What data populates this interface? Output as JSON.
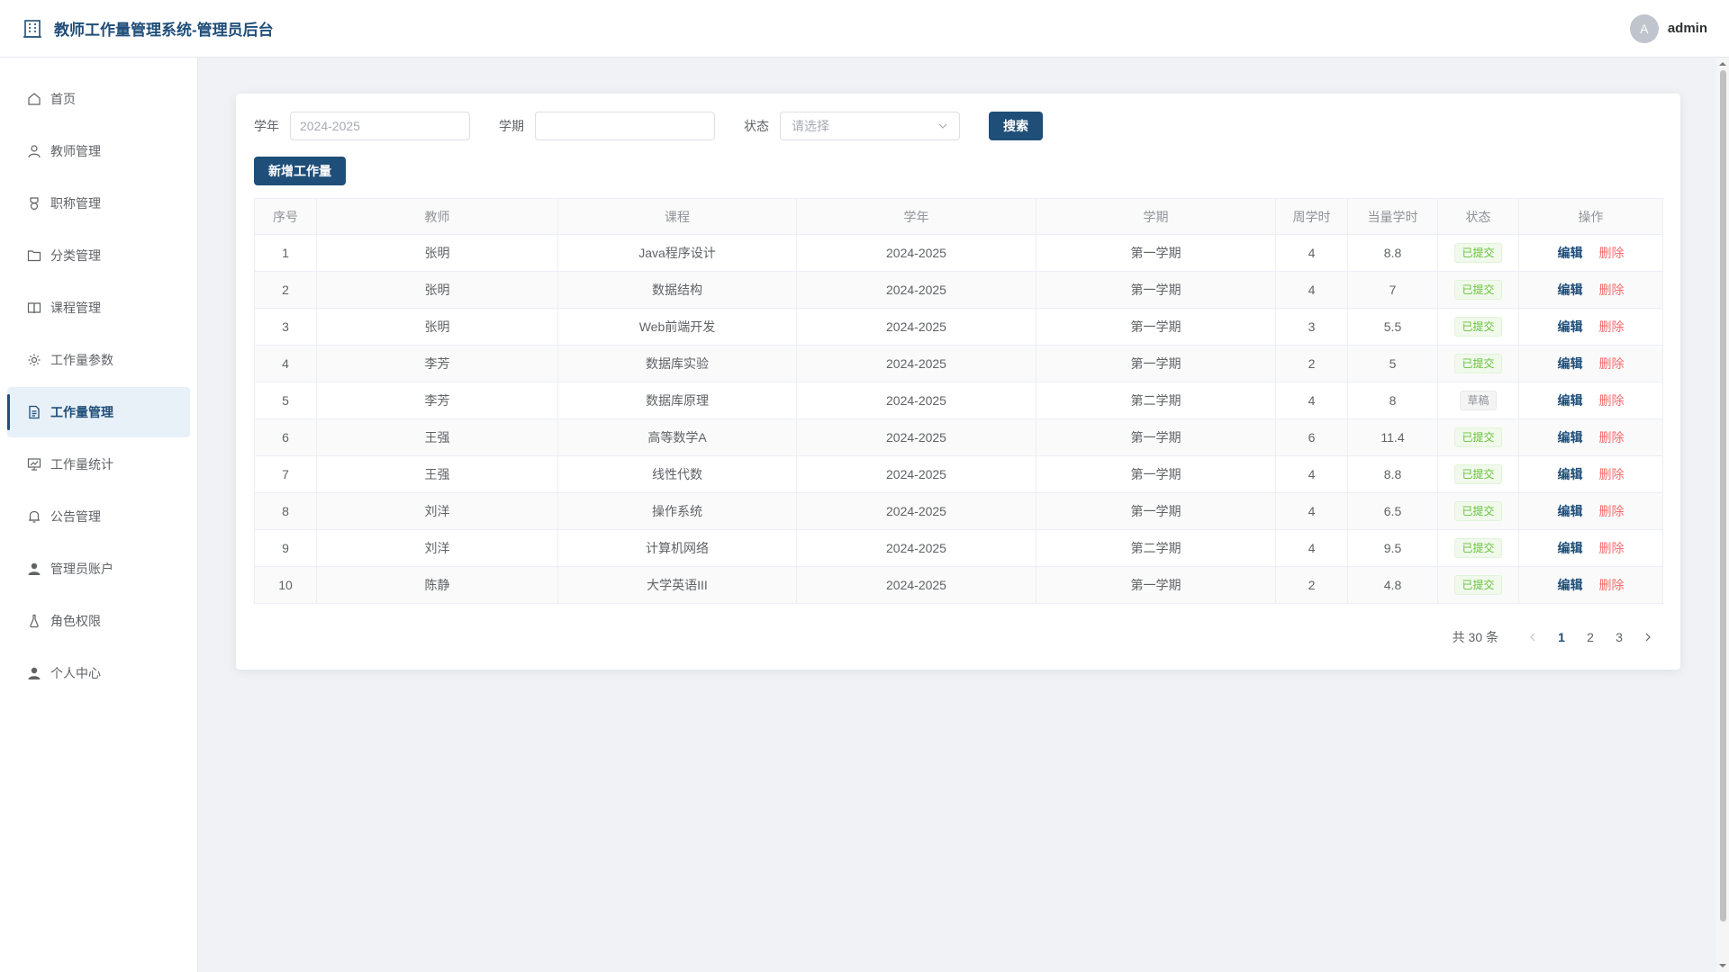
{
  "header": {
    "title": "教师工作量管理系统-管理员后台",
    "avatar_letter": "A",
    "username": "admin"
  },
  "sidebar": {
    "items": [
      {
        "label": "首页",
        "icon": "home-icon"
      },
      {
        "label": "教师管理",
        "icon": "user-icon"
      },
      {
        "label": "职称管理",
        "icon": "medal-icon"
      },
      {
        "label": "分类管理",
        "icon": "folder-icon"
      },
      {
        "label": "课程管理",
        "icon": "book-icon"
      },
      {
        "label": "工作量参数",
        "icon": "gear-icon"
      },
      {
        "label": "工作量管理",
        "icon": "document-icon",
        "active": true
      },
      {
        "label": "工作量统计",
        "icon": "chart-board-icon"
      },
      {
        "label": "公告管理",
        "icon": "bell-icon"
      },
      {
        "label": "管理员账户",
        "icon": "user-filled-icon"
      },
      {
        "label": "角色权限",
        "icon": "flask-icon"
      },
      {
        "label": "个人中心",
        "icon": "user-filled-icon"
      }
    ]
  },
  "filters": {
    "year_label": "学年",
    "year_placeholder": "2024-2025",
    "term_label": "学期",
    "term_placeholder": "",
    "status_label": "状态",
    "status_placeholder": "请选择",
    "search_label": "搜索"
  },
  "add_button": "新增工作量",
  "table": {
    "headers": [
      "序号",
      "教师",
      "课程",
      "学年",
      "学期",
      "周学时",
      "当量学时",
      "状态",
      "操作"
    ],
    "edit_label": "编辑",
    "delete_label": "删除",
    "rows": [
      {
        "no": "1",
        "teacher": "张明",
        "course": "Java程序设计",
        "year": "2024-2025",
        "term": "第一学期",
        "weekly": "4",
        "equiv": "8.8",
        "status": "已提交"
      },
      {
        "no": "2",
        "teacher": "张明",
        "course": "数据结构",
        "year": "2024-2025",
        "term": "第一学期",
        "weekly": "4",
        "equiv": "7",
        "status": "已提交"
      },
      {
        "no": "3",
        "teacher": "张明",
        "course": "Web前端开发",
        "year": "2024-2025",
        "term": "第一学期",
        "weekly": "3",
        "equiv": "5.5",
        "status": "已提交"
      },
      {
        "no": "4",
        "teacher": "李芳",
        "course": "数据库实验",
        "year": "2024-2025",
        "term": "第一学期",
        "weekly": "2",
        "equiv": "5",
        "status": "已提交"
      },
      {
        "no": "5",
        "teacher": "李芳",
        "course": "数据库原理",
        "year": "2024-2025",
        "term": "第二学期",
        "weekly": "4",
        "equiv": "8",
        "status": "草稿"
      },
      {
        "no": "6",
        "teacher": "王强",
        "course": "高等数学A",
        "year": "2024-2025",
        "term": "第一学期",
        "weekly": "6",
        "equiv": "11.4",
        "status": "已提交"
      },
      {
        "no": "7",
        "teacher": "王强",
        "course": "线性代数",
        "year": "2024-2025",
        "term": "第一学期",
        "weekly": "4",
        "equiv": "8.8",
        "status": "已提交"
      },
      {
        "no": "8",
        "teacher": "刘洋",
        "course": "操作系统",
        "year": "2024-2025",
        "term": "第一学期",
        "weekly": "4",
        "equiv": "6.5",
        "status": "已提交"
      },
      {
        "no": "9",
        "teacher": "刘洋",
        "course": "计算机网络",
        "year": "2024-2025",
        "term": "第二学期",
        "weekly": "4",
        "equiv": "9.5",
        "status": "已提交"
      },
      {
        "no": "10",
        "teacher": "陈静",
        "course": "大学英语III",
        "year": "2024-2025",
        "term": "第一学期",
        "weekly": "2",
        "equiv": "4.8",
        "status": "已提交"
      }
    ]
  },
  "pagination": {
    "total_text": "共 30 条",
    "pages": [
      "1",
      "2",
      "3"
    ],
    "current": "1"
  },
  "colors": {
    "primary": "#1f4e79",
    "success": "#67c23a",
    "danger": "#f56c6c",
    "draft": "#909399"
  }
}
